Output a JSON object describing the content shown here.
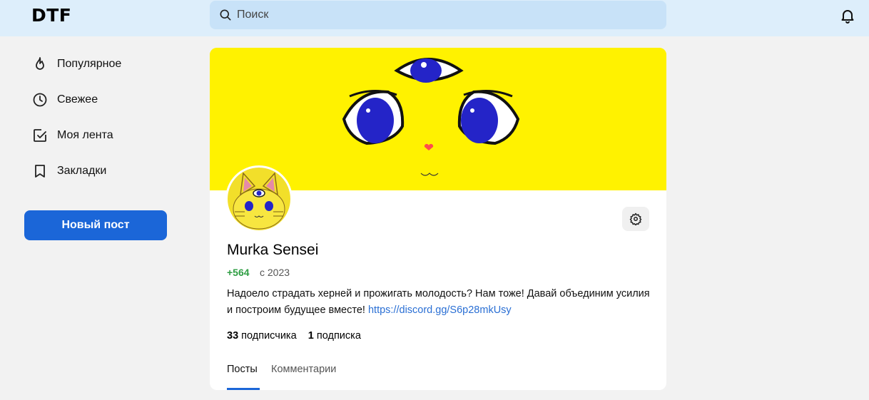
{
  "header": {
    "logo": "DTF",
    "search_placeholder": "Поиск"
  },
  "sidebar": {
    "items": [
      {
        "label": "Популярное",
        "icon": "flame-icon"
      },
      {
        "label": "Свежее",
        "icon": "clock-icon"
      },
      {
        "label": "Моя лента",
        "icon": "feed-check-icon"
      },
      {
        "label": "Закладки",
        "icon": "bookmark-icon"
      }
    ],
    "new_post_label": "Новый пост"
  },
  "profile": {
    "name": "Murka Sensei",
    "rating": "+564",
    "since": "с 2023",
    "bio_text": "Надоело страдать херней и прожигать молодость? Нам тоже! Давай объединим усилия и построим будущее вместе! ",
    "bio_link": "https://discord.gg/S6p28mkUsy",
    "followers_count": "33",
    "followers_label": "подписчика",
    "following_count": "1",
    "following_label": "подписка",
    "tabs": [
      {
        "label": "Посты",
        "active": true
      },
      {
        "label": "Комментарии",
        "active": false
      }
    ]
  },
  "colors": {
    "accent": "#1b66d8",
    "cover": "#fff200",
    "rating": "#2f9e44",
    "header_bg": "#ddeefb"
  }
}
